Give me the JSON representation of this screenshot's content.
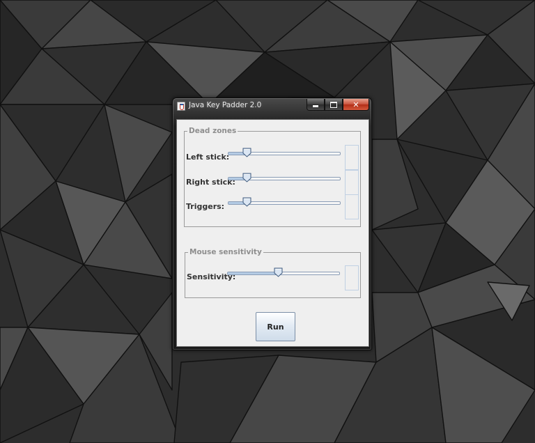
{
  "window": {
    "title": "Java Key Padder 2.0",
    "controls": {
      "minimize": "minimize",
      "maximize": "maximize",
      "close": "✕"
    }
  },
  "dead_zones": {
    "title": "Dead zones",
    "sliders": [
      {
        "label": "Left stick:",
        "value": 0.14
      },
      {
        "label": "Right stick:",
        "value": 0.14
      },
      {
        "label": "Triggers:",
        "value": 0.14
      }
    ]
  },
  "mouse_sensitivity": {
    "title": "Mouse sensitivity",
    "sliders": [
      {
        "label": "Sensitivity:",
        "value": 0.45
      }
    ]
  },
  "run_button": {
    "label": "Run"
  },
  "colors": {
    "client_bg": "#efefef",
    "track_fill": "#b4cbe4",
    "close_button": "#c8503a",
    "thumb": "#dbe6f3"
  }
}
